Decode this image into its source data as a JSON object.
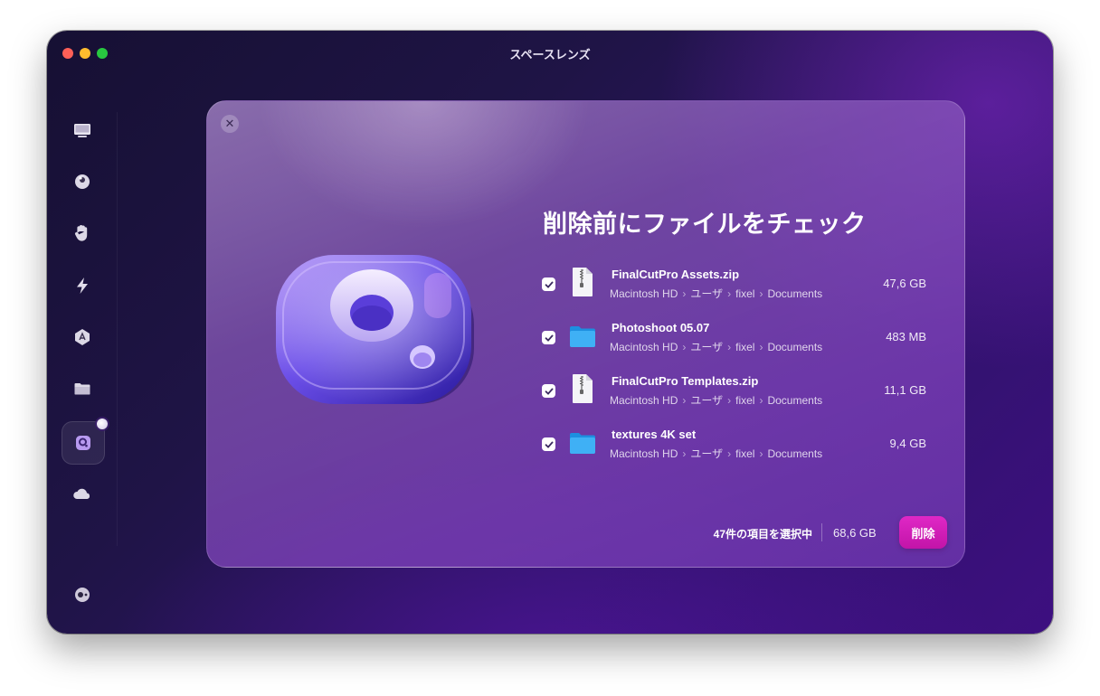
{
  "window": {
    "title": "スペースレンズ"
  },
  "sidebar": {
    "items": [
      {
        "name": "smart-scan",
        "icon": "display-icon"
      },
      {
        "name": "cleanup",
        "icon": "bubble-icon"
      },
      {
        "name": "protection",
        "icon": "hand-icon"
      },
      {
        "name": "performance",
        "icon": "lightning-icon"
      },
      {
        "name": "applications",
        "icon": "app-store-icon"
      },
      {
        "name": "my-clutter",
        "icon": "folder-icon"
      },
      {
        "name": "space-lens",
        "icon": "space-lens-icon",
        "active": true
      },
      {
        "name": "cloud-cleanup",
        "icon": "cloud-icon"
      }
    ],
    "bottom_item": {
      "name": "assistant",
      "icon": "assistant-icon"
    }
  },
  "panel": {
    "heading": "削除前にファイルをチェック",
    "files": [
      {
        "name": "FinalCutPro Assets.zip",
        "path": [
          "Macintosh HD",
          "ユーザ",
          "fixel",
          "Documents"
        ],
        "size": "47,6 GB",
        "type": "zip",
        "checked": true
      },
      {
        "name": "Photoshoot 05.07",
        "path": [
          "Macintosh HD",
          "ユーザ",
          "fixel",
          "Documents"
        ],
        "size": "483 MB",
        "type": "folder",
        "checked": true
      },
      {
        "name": "FinalCutPro Templates.zip",
        "path": [
          "Macintosh HD",
          "ユーザ",
          "fixel",
          "Documents"
        ],
        "size": "11,1 GB",
        "type": "zip",
        "checked": true
      },
      {
        "name": "textures 4K set",
        "path": [
          "Macintosh HD",
          "ユーザ",
          "fixel",
          "Documents"
        ],
        "size": "9,4 GB",
        "type": "folder",
        "checked": true
      }
    ],
    "footer": {
      "selected_count": "47件の項目を選択中",
      "total_size": "68,6 GB",
      "delete_label": "削除"
    }
  },
  "colors": {
    "accent": "#d41fb9",
    "background": "#2a1560"
  }
}
